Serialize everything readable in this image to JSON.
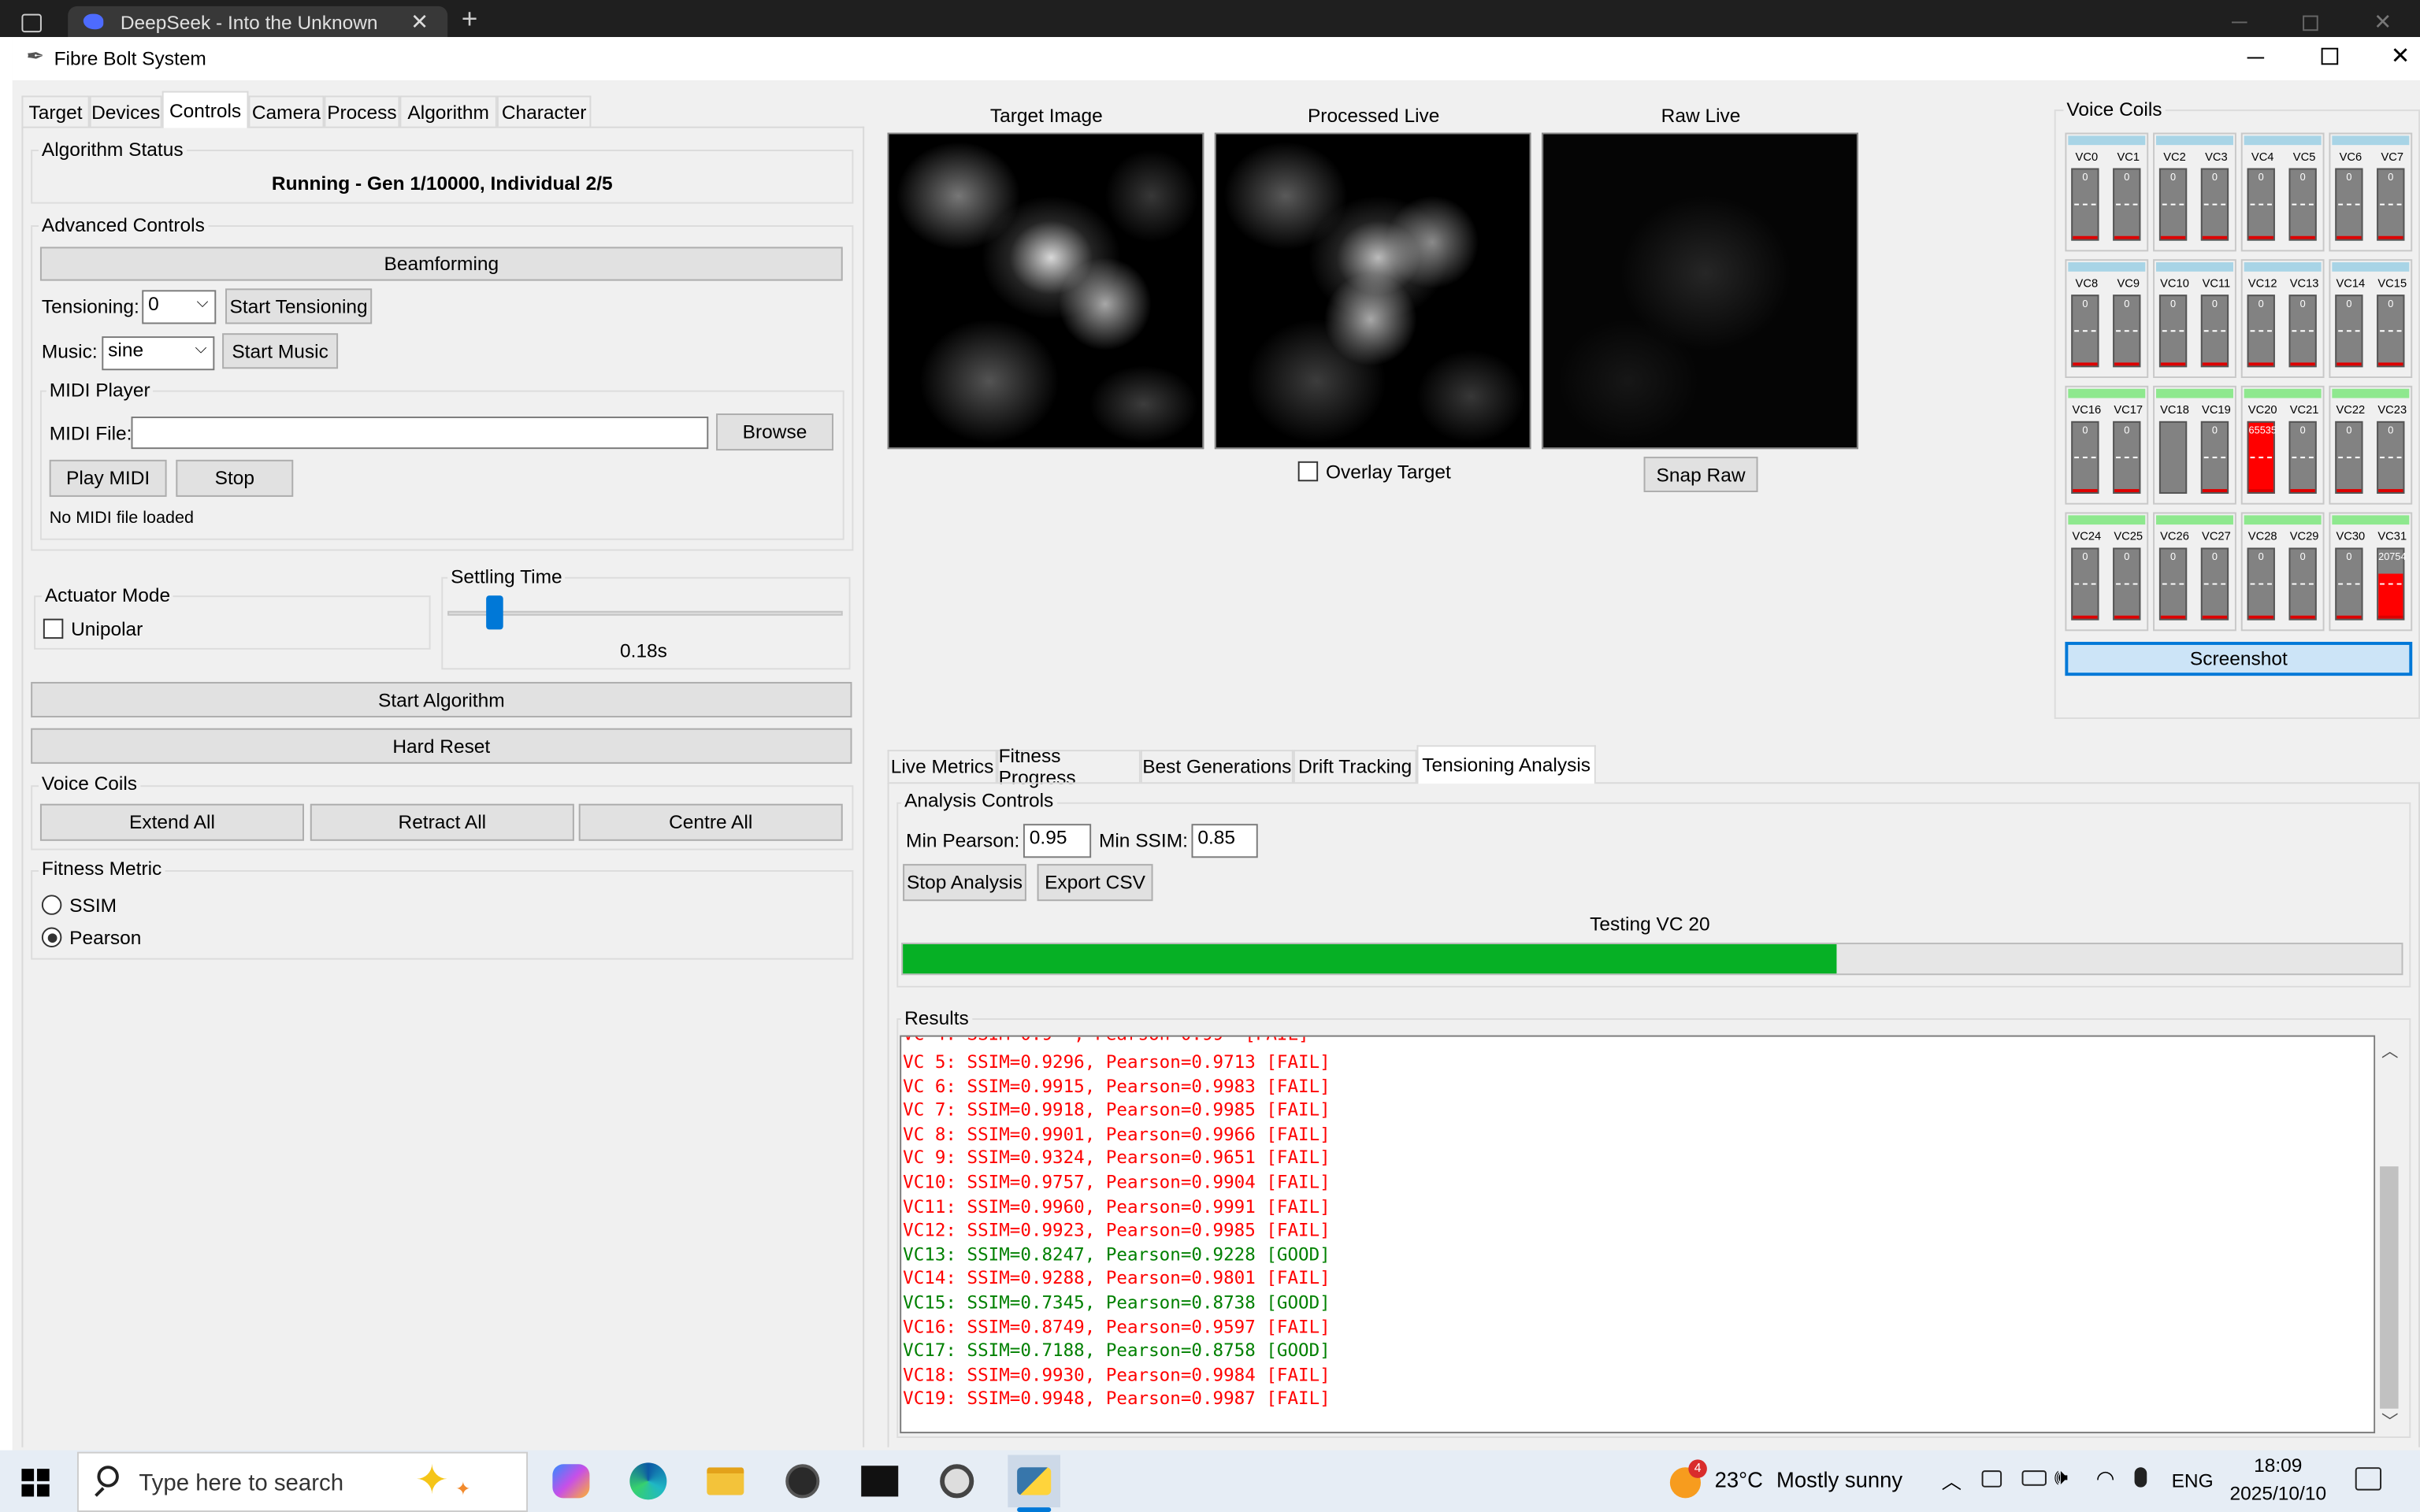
{
  "browser": {
    "tab_title": "DeepSeek - Into the Unknown"
  },
  "window": {
    "title": "Fibre Bolt System"
  },
  "tabs": [
    "Target",
    "Devices",
    "Controls",
    "Camera",
    "Process",
    "Algorithm",
    "Character"
  ],
  "algorithm_status": {
    "title": "Algorithm Status",
    "text": "Running - Gen 1/10000, Individual 2/5"
  },
  "advanced": {
    "title": "Advanced Controls",
    "beamforming": "Beamforming",
    "tensioning_label": "Tensioning:",
    "tensioning_value": "0",
    "start_tensioning": "Start Tensioning",
    "music_label": "Music:",
    "music_value": "sine",
    "start_music": "Start Music"
  },
  "midi": {
    "title": "MIDI Player",
    "file_label": "MIDI File:",
    "file_value": "",
    "browse": "Browse",
    "play": "Play MIDI",
    "stop": "Stop",
    "status": "No MIDI file loaded"
  },
  "actuator": {
    "title": "Actuator Mode",
    "unipolar": "Unipolar"
  },
  "settling": {
    "title": "Settling Time",
    "value": "0.18s",
    "level": 0.1
  },
  "buttons": {
    "start_algorithm": "Start Algorithm",
    "hard_reset": "Hard Reset"
  },
  "voice_coils_ctrl": {
    "title": "Voice Coils",
    "extend": "Extend All",
    "retract": "Retract All",
    "centre": "Centre All"
  },
  "fitness": {
    "title": "Fitness Metric",
    "ssim": "SSIM",
    "pearson": "Pearson"
  },
  "images": {
    "target": "Target Image",
    "processed": "Processed Live",
    "raw": "Raw Live",
    "overlay": "Overlay Target",
    "snap_raw": "Snap Raw"
  },
  "voice_coils_panel": {
    "title": "Voice Coils",
    "screenshot": "Screenshot",
    "coils": [
      {
        "label": "VC0",
        "value": "0"
      },
      {
        "label": "VC1",
        "value": "0"
      },
      {
        "label": "VC2",
        "value": "0"
      },
      {
        "label": "VC3",
        "value": "0"
      },
      {
        "label": "VC4",
        "value": "0"
      },
      {
        "label": "VC5",
        "value": "0"
      },
      {
        "label": "VC6",
        "value": "0"
      },
      {
        "label": "VC7",
        "value": "0"
      },
      {
        "label": "VC8",
        "value": "0"
      },
      {
        "label": "VC9",
        "value": "0"
      },
      {
        "label": "VC10",
        "value": "0"
      },
      {
        "label": "VC11",
        "value": "0"
      },
      {
        "label": "VC12",
        "value": "0"
      },
      {
        "label": "VC13",
        "value": "0"
      },
      {
        "label": "VC14",
        "value": "0"
      },
      {
        "label": "VC15",
        "value": "0"
      },
      {
        "label": "VC16",
        "value": "0"
      },
      {
        "label": "VC17",
        "value": "0"
      },
      {
        "label": "VC18",
        "value": ""
      },
      {
        "label": "VC19",
        "value": "0"
      },
      {
        "label": "VC20",
        "value": "65535"
      },
      {
        "label": "VC21",
        "value": "0"
      },
      {
        "label": "VC22",
        "value": "0"
      },
      {
        "label": "VC23",
        "value": "0"
      },
      {
        "label": "VC24",
        "value": "0"
      },
      {
        "label": "VC25",
        "value": "0"
      },
      {
        "label": "VC26",
        "value": "0"
      },
      {
        "label": "VC27",
        "value": "0"
      },
      {
        "label": "VC28",
        "value": "0"
      },
      {
        "label": "VC29",
        "value": "0"
      },
      {
        "label": "VC30",
        "value": "0"
      },
      {
        "label": "VC31",
        "value": "20754"
      }
    ]
  },
  "analysis_tabs": [
    "Live Metrics",
    "Fitness Progress",
    "Best Generations",
    "Drift Tracking",
    "Tensioning Analysis"
  ],
  "analysis": {
    "title": "Analysis Controls",
    "min_pearson_label": "Min Pearson:",
    "min_pearson": "0.95",
    "min_ssim_label": "Min SSIM:",
    "min_ssim": "0.85",
    "stop": "Stop Analysis",
    "export": "Export CSV",
    "progress_text": "Testing VC 20",
    "progress": 0.623
  },
  "results": {
    "title": "Results",
    "lines": [
      {
        "text": "VC 5: SSIM=0.9296, Pearson=0.9713 [FAIL]",
        "status": "fail"
      },
      {
        "text": "VC 6: SSIM=0.9915, Pearson=0.9983 [FAIL]",
        "status": "fail"
      },
      {
        "text": "VC 7: SSIM=0.9918, Pearson=0.9985 [FAIL]",
        "status": "fail"
      },
      {
        "text": "VC 8: SSIM=0.9901, Pearson=0.9966 [FAIL]",
        "status": "fail"
      },
      {
        "text": "VC 9: SSIM=0.9324, Pearson=0.9651 [FAIL]",
        "status": "fail"
      },
      {
        "text": "VC10: SSIM=0.9757, Pearson=0.9904 [FAIL]",
        "status": "fail"
      },
      {
        "text": "VC11: SSIM=0.9960, Pearson=0.9991 [FAIL]",
        "status": "fail"
      },
      {
        "text": "VC12: SSIM=0.9923, Pearson=0.9985 [FAIL]",
        "status": "fail"
      },
      {
        "text": "VC13: SSIM=0.8247, Pearson=0.9228 [GOOD]",
        "status": "good"
      },
      {
        "text": "VC14: SSIM=0.9288, Pearson=0.9801 [FAIL]",
        "status": "fail"
      },
      {
        "text": "VC15: SSIM=0.7345, Pearson=0.8738 [GOOD]",
        "status": "good"
      },
      {
        "text": "VC16: SSIM=0.8749, Pearson=0.9597 [FAIL]",
        "status": "fail"
      },
      {
        "text": "VC17: SSIM=0.7188, Pearson=0.8758 [GOOD]",
        "status": "good"
      },
      {
        "text": "VC18: SSIM=0.9930, Pearson=0.9984 [FAIL]",
        "status": "fail"
      },
      {
        "text": "VC19: SSIM=0.9948, Pearson=0.9987 [FAIL]",
        "status": "fail"
      }
    ]
  },
  "taskbar": {
    "search_placeholder": "Type here to search",
    "weather_temp": "23°C",
    "weather_text": "Mostly sunny",
    "weather_badge": "4",
    "language": "ENG",
    "time": "18:09",
    "date": "2025/10/10"
  },
  "colors": {
    "fail": "#ff0000",
    "good": "#008000",
    "progress": "#06b025",
    "accent": "#0078d7"
  }
}
